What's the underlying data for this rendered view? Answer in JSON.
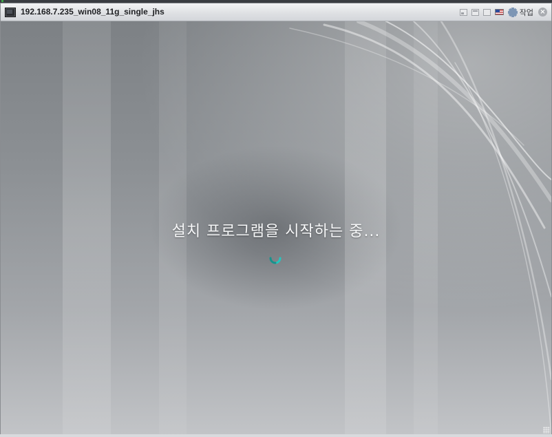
{
  "window": {
    "title": "192.168.7.235_win08_11g_single_jhs",
    "menu_label": "작업",
    "controls": [
      "minimize-button",
      "restore-button",
      "maximize-button",
      "keyboard-flag-icon",
      "settings-gear-icon",
      "close-icon"
    ]
  },
  "screen": {
    "status_text": "설치 프로그램을 시작하는 중...",
    "spinner_color": "#26c6bf",
    "background_color": "#8a8e92"
  },
  "colors": {
    "titlebar": "#e4e6e8",
    "title_text": "#1e1f22"
  }
}
